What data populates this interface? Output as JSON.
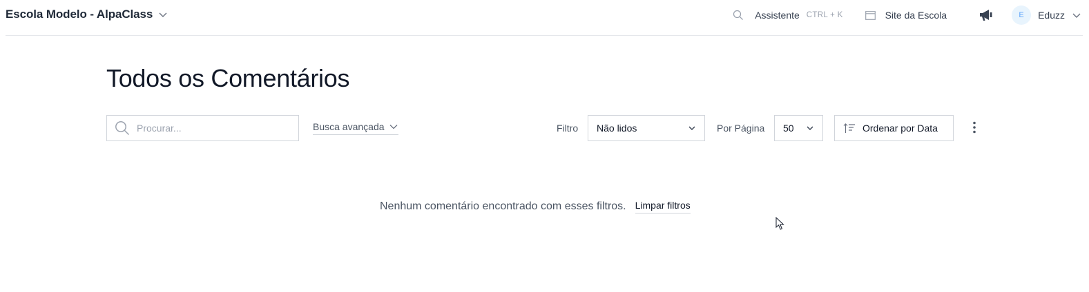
{
  "header": {
    "school_name": "Escola Modelo - AlpaClass",
    "assistant_label": "Assistente",
    "assistant_shortcut": "CTRL + K",
    "site_label": "Site da Escola",
    "user_initial": "E",
    "user_name": "Eduzz"
  },
  "page": {
    "title": "Todos os Comentários"
  },
  "toolbar": {
    "search_placeholder": "Procurar...",
    "advanced_search_label": "Busca avançada",
    "filter_label": "Filtro",
    "filter_value": "Não lidos",
    "per_page_label": "Por Página",
    "per_page_value": "50",
    "sort_label": "Ordenar por Data"
  },
  "empty_state": {
    "message": "Nenhum comentário encontrado com esses filtros.",
    "clear_filters_label": "Limpar filtros"
  },
  "colors": {
    "avatar_bg": "#e8f4fd",
    "avatar_text": "#60a5fa",
    "border": "#d1d5db"
  }
}
